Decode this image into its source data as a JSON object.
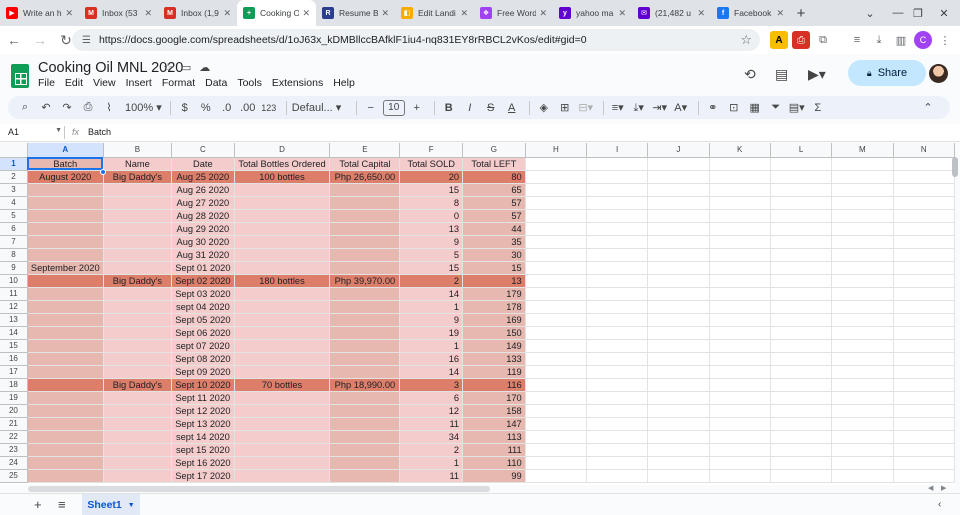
{
  "browser": {
    "tabs": [
      {
        "label": "Write an h",
        "favicon": "youtube-icon",
        "color": "#ff0000",
        "glyph": "▶"
      },
      {
        "label": "Inbox (53",
        "favicon": "gmail-icon",
        "color": "#d93025",
        "glyph": "M"
      },
      {
        "label": "Inbox (1,9",
        "favicon": "gmail-icon",
        "color": "#d93025",
        "glyph": "M"
      },
      {
        "label": "Cooking O",
        "favicon": "sheets-icon",
        "color": "#0f9d58",
        "glyph": "+"
      },
      {
        "label": "Resume Bu",
        "favicon": "resume-icon",
        "color": "#2b3d8f",
        "glyph": "R"
      },
      {
        "label": "Edit Landi",
        "favicon": "edit-icon",
        "color": "#f9ab00",
        "glyph": "◧"
      },
      {
        "label": "Free Word",
        "favicon": "word-icon",
        "color": "#a142f4",
        "glyph": "❖"
      },
      {
        "label": "yahoo ma",
        "favicon": "yahoo-icon",
        "color": "#6001d2",
        "glyph": "y"
      },
      {
        "label": "(21,482 u",
        "favicon": "yahoo-mail-icon",
        "color": "#6001d2",
        "glyph": "✉"
      },
      {
        "label": "Facebook",
        "favicon": "facebook-icon",
        "color": "#1877f2",
        "glyph": "f"
      }
    ],
    "active_tab": 3,
    "url": "https://docs.google.com/spreadsheets/d/1oJ63x_kDMBllccBAfklF1iu4-nq831EY8rRBCL2vKos/edit#gid=0"
  },
  "doc": {
    "title": "Cooking Oil MNL 2020",
    "menu": [
      "File",
      "Edit",
      "View",
      "Insert",
      "Format",
      "Data",
      "Tools",
      "Extensions",
      "Help"
    ],
    "share_label": "Share"
  },
  "toolbar": {
    "zoom": "100%",
    "currency": "$",
    "percent": "%",
    "dec_decrease": ".0",
    "dec_increase": ".00",
    "number_format": "123",
    "font": "Defaul...",
    "font_size": "10"
  },
  "formula_bar": {
    "cell_ref": "A1",
    "fx": "fx",
    "content": "Batch"
  },
  "grid": {
    "columns": [
      "A",
      "B",
      "C",
      "D",
      "E",
      "F",
      "G",
      "H",
      "I",
      "J",
      "K",
      "L",
      "M",
      "N"
    ],
    "headers": [
      "Batch",
      "Name",
      "Date",
      "Total Bottles Ordered",
      "Total Capital",
      "Total SOLD",
      "Total LEFT"
    ],
    "rows": [
      {
        "n": "2",
        "batch": "August 2020",
        "name": "Big Daddy's",
        "date": "Aug 25 2020",
        "ordered": "100 bottles",
        "capital": "Php 26,650.00",
        "sold": "20",
        "left": "80",
        "hl": true
      },
      {
        "n": "3",
        "batch": "",
        "name": "",
        "date": "Aug 26 2020",
        "ordered": "",
        "capital": "",
        "sold": "15",
        "left": "65",
        "hl": false
      },
      {
        "n": "4",
        "batch": "",
        "name": "",
        "date": "Aug 27 2020",
        "ordered": "",
        "capital": "",
        "sold": "8",
        "left": "57",
        "hl": false
      },
      {
        "n": "5",
        "batch": "",
        "name": "",
        "date": "Aug 28 2020",
        "ordered": "",
        "capital": "",
        "sold": "0",
        "left": "57",
        "hl": false
      },
      {
        "n": "6",
        "batch": "",
        "name": "",
        "date": "Aug 29 2020",
        "ordered": "",
        "capital": "",
        "sold": "13",
        "left": "44",
        "hl": false
      },
      {
        "n": "7",
        "batch": "",
        "name": "",
        "date": "Aug 30 2020",
        "ordered": "",
        "capital": "",
        "sold": "9",
        "left": "35",
        "hl": false
      },
      {
        "n": "8",
        "batch": "",
        "name": "",
        "date": "Aug 31 2020",
        "ordered": "",
        "capital": "",
        "sold": "5",
        "left": "30",
        "hl": false
      },
      {
        "n": "9",
        "batch": "September 2020",
        "name": "",
        "date": "Sept 01 2020",
        "ordered": "",
        "capital": "",
        "sold": "15",
        "left": "15",
        "hl": false
      },
      {
        "n": "10",
        "batch": "",
        "name": "Big Daddy's",
        "date": "Sept 02 2020",
        "ordered": "180 bottles",
        "capital": "Php 39,970.00",
        "sold": "2",
        "left": "13",
        "hl": true
      },
      {
        "n": "11",
        "batch": "",
        "name": "",
        "date": "Sept 03 2020",
        "ordered": "",
        "capital": "",
        "sold": "14",
        "left": "179",
        "hl": false
      },
      {
        "n": "12",
        "batch": "",
        "name": "",
        "date": "sept 04 2020",
        "ordered": "",
        "capital": "",
        "sold": "1",
        "left": "178",
        "hl": false
      },
      {
        "n": "13",
        "batch": "",
        "name": "",
        "date": "Sept 05 2020",
        "ordered": "",
        "capital": "",
        "sold": "9",
        "left": "169",
        "hl": false
      },
      {
        "n": "14",
        "batch": "",
        "name": "",
        "date": "Sept 06 2020",
        "ordered": "",
        "capital": "",
        "sold": "19",
        "left": "150",
        "hl": false
      },
      {
        "n": "15",
        "batch": "",
        "name": "",
        "date": "sept 07 2020",
        "ordered": "",
        "capital": "",
        "sold": "1",
        "left": "149",
        "hl": false
      },
      {
        "n": "16",
        "batch": "",
        "name": "",
        "date": "Sept 08 2020",
        "ordered": "",
        "capital": "",
        "sold": "16",
        "left": "133",
        "hl": false
      },
      {
        "n": "17",
        "batch": "",
        "name": "",
        "date": "Sept 09 2020",
        "ordered": "",
        "capital": "",
        "sold": "14",
        "left": "119",
        "hl": false
      },
      {
        "n": "18",
        "batch": "",
        "name": "Big Daddy's",
        "date": "Sept 10 2020",
        "ordered": "70 bottles",
        "capital": "Php 18,990.00",
        "sold": "3",
        "left": "116",
        "hl": true
      },
      {
        "n": "19",
        "batch": "",
        "name": "",
        "date": "Sept 11 2020",
        "ordered": "",
        "capital": "",
        "sold": "6",
        "left": "170",
        "hl": false
      },
      {
        "n": "20",
        "batch": "",
        "name": "",
        "date": "Sept 12 2020",
        "ordered": "",
        "capital": "",
        "sold": "12",
        "left": "158",
        "hl": false
      },
      {
        "n": "21",
        "batch": "",
        "name": "",
        "date": "Sept 13 2020",
        "ordered": "",
        "capital": "",
        "sold": "11",
        "left": "147",
        "hl": false
      },
      {
        "n": "22",
        "batch": "",
        "name": "",
        "date": "sept 14 2020",
        "ordered": "",
        "capital": "",
        "sold": "34",
        "left": "113",
        "hl": false
      },
      {
        "n": "23",
        "batch": "",
        "name": "",
        "date": "sept 15 2020",
        "ordered": "",
        "capital": "",
        "sold": "2",
        "left": "111",
        "hl": false
      },
      {
        "n": "24",
        "batch": "",
        "name": "",
        "date": "Sept 16 2020",
        "ordered": "",
        "capital": "",
        "sold": "1",
        "left": "110",
        "hl": false
      },
      {
        "n": "25",
        "batch": "",
        "name": "",
        "date": "Sept 17 2020",
        "ordered": "",
        "capital": "",
        "sold": "11",
        "left": "99",
        "hl": false
      }
    ]
  },
  "sheets": {
    "active": "Sheet1"
  },
  "colors": {
    "batch_row": "#dd7e6b",
    "light_fill": "#f4cccc",
    "medium_fill": "#e6b8af",
    "accent": "#1a73e8"
  }
}
